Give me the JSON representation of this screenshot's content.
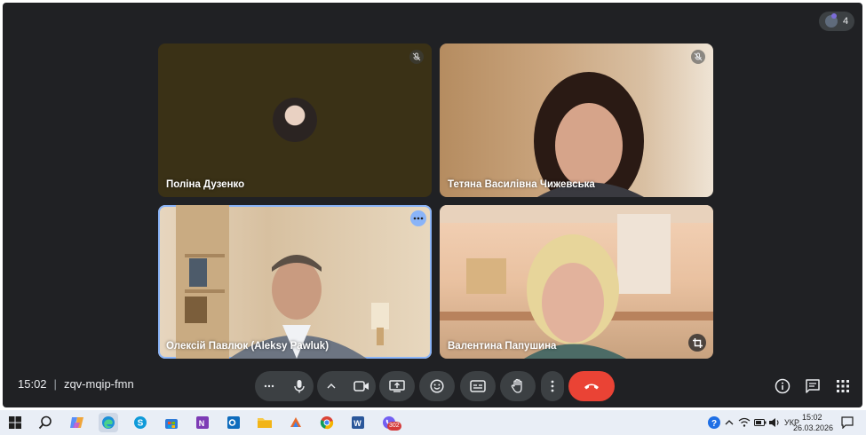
{
  "participants_count": "4",
  "tiles": [
    {
      "name": "Поліна Дузенко"
    },
    {
      "name": "Тетяна Василівна Чижевська"
    },
    {
      "name": "Олексій Павлюк (Aleksy Pawluk)"
    },
    {
      "name": "Валентина Папушина"
    }
  ],
  "meeting": {
    "time": "15:02",
    "separator": "|",
    "code": "zqv-mqip-fmn"
  },
  "taskbar": {
    "lang": "УКР",
    "time": "15:02",
    "date": "26.03.2026",
    "viber_badge": "302"
  },
  "colors": {
    "end_call": "#ea4335",
    "bg": "#202124",
    "button": "#3c4043",
    "active_speaker": "#8ab4f8"
  }
}
